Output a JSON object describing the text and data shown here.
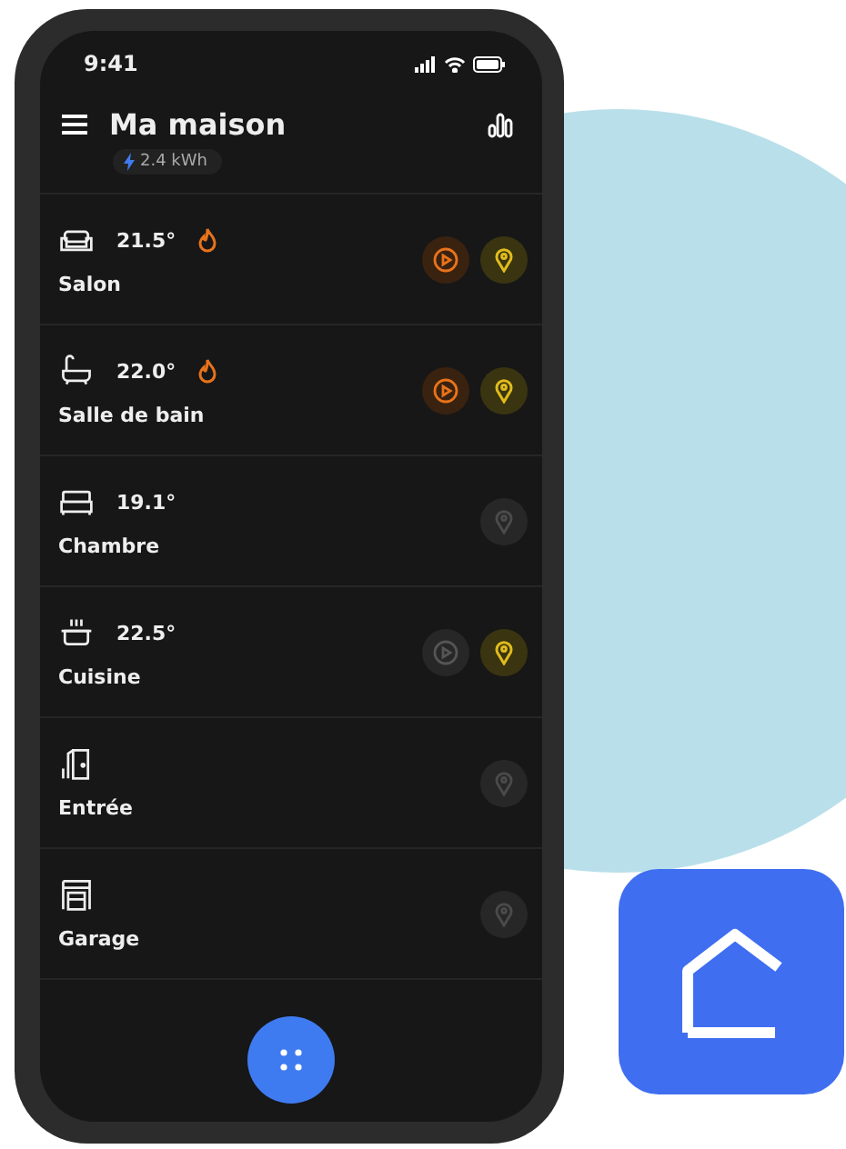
{
  "status_bar": {
    "time": "9:41"
  },
  "header": {
    "title": "Ma maison",
    "energy": "2.4 kWh"
  },
  "rooms": [
    {
      "name": "Salon",
      "kind": "sofa",
      "temperature": "21.5°",
      "heating": true,
      "scene": {
        "on": true
      },
      "light_on": true
    },
    {
      "name": "Salle de bain",
      "kind": "bathtub",
      "temperature": "22.0°",
      "heating": true,
      "scene": {
        "on": true
      },
      "light_on": true
    },
    {
      "name": "Chambre",
      "kind": "bed",
      "temperature": "19.1°",
      "heating": false,
      "light_on": false
    },
    {
      "name": "Cuisine",
      "kind": "pot",
      "temperature": "22.5°",
      "heating": false,
      "scene": {
        "on": false
      },
      "light_on": true
    },
    {
      "name": "Entrée",
      "kind": "door",
      "light_on": false
    },
    {
      "name": "Garage",
      "kind": "garage",
      "light_on": false
    }
  ]
}
